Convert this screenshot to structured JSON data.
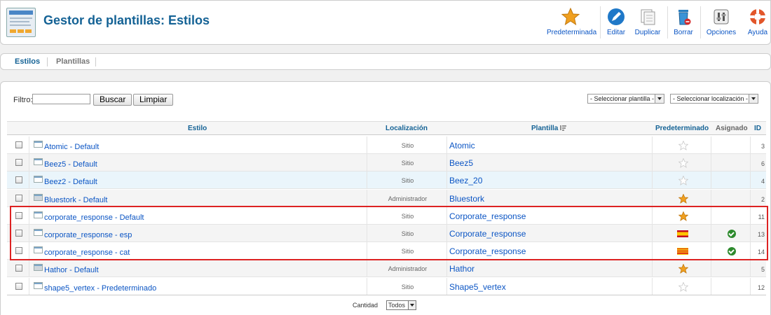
{
  "header": {
    "title": "Gestor de plantillas: Estilos",
    "buttons": [
      {
        "label": "Predeterminada",
        "icon": "star-icon"
      },
      {
        "label": "Editar",
        "icon": "edit-icon"
      },
      {
        "label": "Duplicar",
        "icon": "copy-icon"
      },
      {
        "label": "Borrar",
        "icon": "trash-icon"
      },
      {
        "label": "Opciones",
        "icon": "options-icon"
      },
      {
        "label": "Ayuda",
        "icon": "help-icon"
      }
    ]
  },
  "tabs": [
    {
      "label": "Estilos",
      "active": true
    },
    {
      "label": "Plantillas",
      "active": false
    }
  ],
  "filter": {
    "label": "Filtro:",
    "value": "",
    "search_button": "Buscar",
    "clear_button": "Limpiar",
    "template_select": "- Seleccionar plantilla -",
    "location_select": "- Seleccionar localización -"
  },
  "table": {
    "columns": {
      "estilo": "Estilo",
      "localizacion": "Localización",
      "plantilla": "Plantilla",
      "predeterminado": "Predeterminado",
      "asignado": "Asignado",
      "id": "ID"
    },
    "rows": [
      {
        "estilo": "Atomic - Default",
        "localizacion": "Sitio",
        "plantilla": "Atomic",
        "default": "star-empty",
        "asignado": false,
        "id": "3"
      },
      {
        "estilo": "Beez5 - Default",
        "localizacion": "Sitio",
        "plantilla": "Beez5",
        "default": "star-empty",
        "asignado": false,
        "id": "6"
      },
      {
        "estilo": "Beez2 - Default",
        "localizacion": "Sitio",
        "plantilla": "Beez_20",
        "default": "star-empty",
        "asignado": false,
        "id": "4"
      },
      {
        "estilo": "Bluestork - Default",
        "localizacion": "Administrador",
        "plantilla": "Bluestork",
        "default": "star-full",
        "asignado": false,
        "id": "2"
      },
      {
        "estilo": "corporate_response - Default",
        "localizacion": "Sitio",
        "plantilla": "Corporate_response",
        "default": "star-full",
        "asignado": false,
        "id": "11"
      },
      {
        "estilo": "corporate_response - esp",
        "localizacion": "Sitio",
        "plantilla": "Corporate_response",
        "default": "flag-es",
        "asignado": true,
        "id": "13"
      },
      {
        "estilo": "corporate_response - cat",
        "localizacion": "Sitio",
        "plantilla": "Corporate_response",
        "default": "flag-cat",
        "asignado": true,
        "id": "14"
      },
      {
        "estilo": "Hathor - Default",
        "localizacion": "Administrador",
        "plantilla": "Hathor",
        "default": "star-full",
        "asignado": false,
        "id": "5"
      },
      {
        "estilo": "shape5_vertex - Predeterminado",
        "localizacion": "Sitio",
        "plantilla": "Shape5_vertex",
        "default": "star-empty",
        "asignado": false,
        "id": "12"
      }
    ]
  },
  "footer": {
    "limit_label": "Cantidad",
    "limit_value": "Todos"
  },
  "colors": {
    "link": "#0b55c4",
    "title": "#146295",
    "highlight_border": "#dd2222",
    "star": "#f0a020",
    "assigned": "#2d8a2d"
  }
}
